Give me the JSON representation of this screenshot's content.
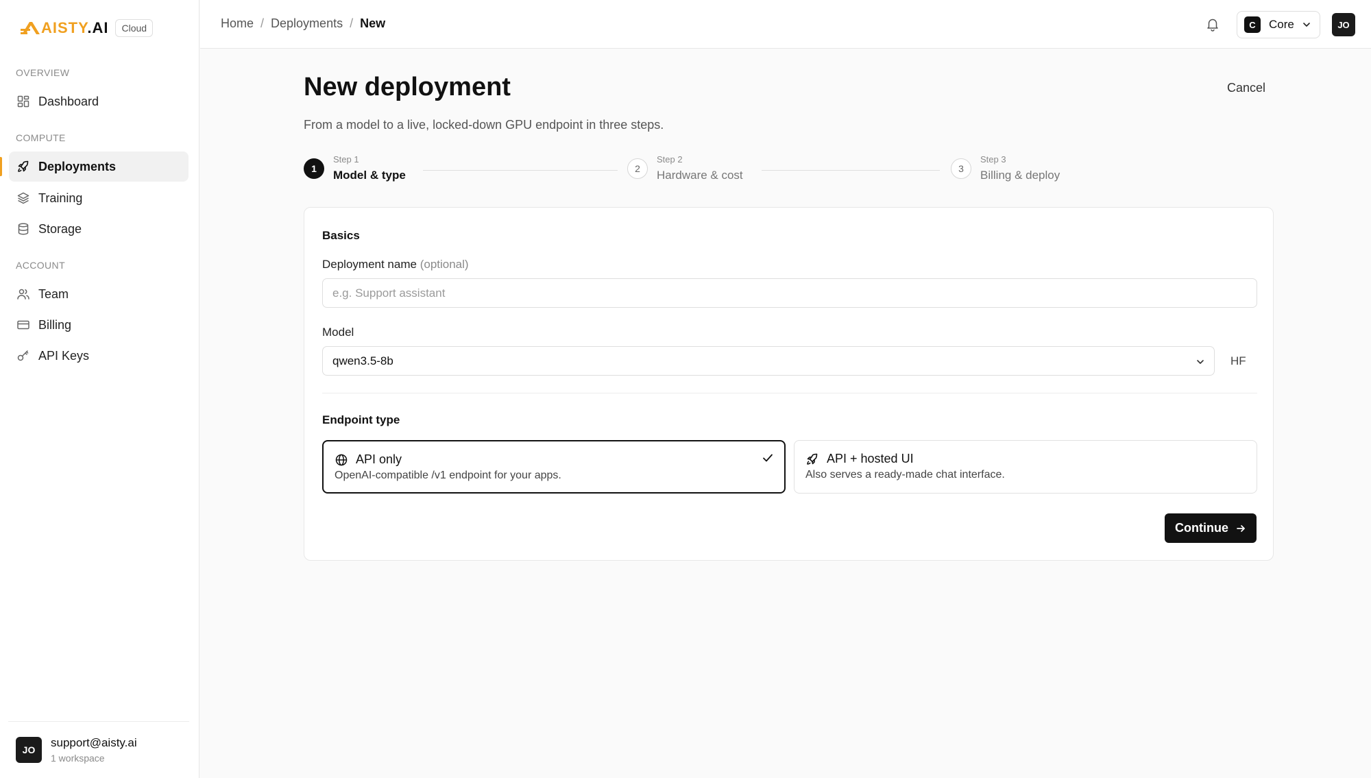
{
  "brand": {
    "logo_text_accent": "AISTY",
    "logo_text_rest": ".AI",
    "badge": "Cloud",
    "accent_color": "#f0a020"
  },
  "sidebar": {
    "sections": {
      "overview": "OVERVIEW",
      "compute": "COMPUTE",
      "account": "ACCOUNT"
    },
    "items": [
      {
        "label": "Dashboard",
        "icon": "grid-icon",
        "active": false
      },
      {
        "label": "Deployments",
        "icon": "rocket-icon",
        "active": true
      },
      {
        "label": "Training",
        "icon": "layers-icon",
        "active": false
      },
      {
        "label": "Storage",
        "icon": "database-icon",
        "active": false
      },
      {
        "label": "Team",
        "icon": "users-icon",
        "active": false
      },
      {
        "label": "Billing",
        "icon": "credit-card-icon",
        "active": false
      },
      {
        "label": "API Keys",
        "icon": "key-icon",
        "active": false
      }
    ],
    "user": {
      "initials": "JO",
      "email": "support@aisty.ai",
      "workspaces": "1 workspace"
    }
  },
  "topbar": {
    "breadcrumb": [
      "Home",
      "Deployments",
      "New"
    ],
    "separator": "/",
    "workspace": {
      "letter": "C",
      "name": "Core"
    },
    "avatar_initials": "JO"
  },
  "page": {
    "title": "New deployment",
    "subtitle": "From a model to a live, locked-down GPU endpoint in three steps.",
    "cancel_label": "Cancel"
  },
  "stepper": [
    {
      "number": "1",
      "step_label": "Step 1",
      "title": "Model & type",
      "current": true
    },
    {
      "number": "2",
      "step_label": "Step 2",
      "title": "Hardware & cost",
      "current": false
    },
    {
      "number": "3",
      "step_label": "Step 3",
      "title": "Billing & deploy",
      "current": false
    }
  ],
  "form": {
    "basics_title": "Basics",
    "name_label": "Deployment name",
    "name_optional": "(optional)",
    "name_value": "",
    "name_placeholder": "e.g. Support assistant",
    "model_label": "Model",
    "model_value": "qwen3.5-8b",
    "model_source": "HF",
    "endpoint_title": "Endpoint type",
    "endpoint_options": [
      {
        "title": "API only",
        "description": "OpenAI-compatible /v1 endpoint for your apps.",
        "icon": "globe-icon",
        "selected": true
      },
      {
        "title": "API + hosted UI",
        "description": "Also serves a ready-made chat interface.",
        "icon": "rocket-icon",
        "selected": false
      }
    ],
    "continue_label": "Continue"
  }
}
